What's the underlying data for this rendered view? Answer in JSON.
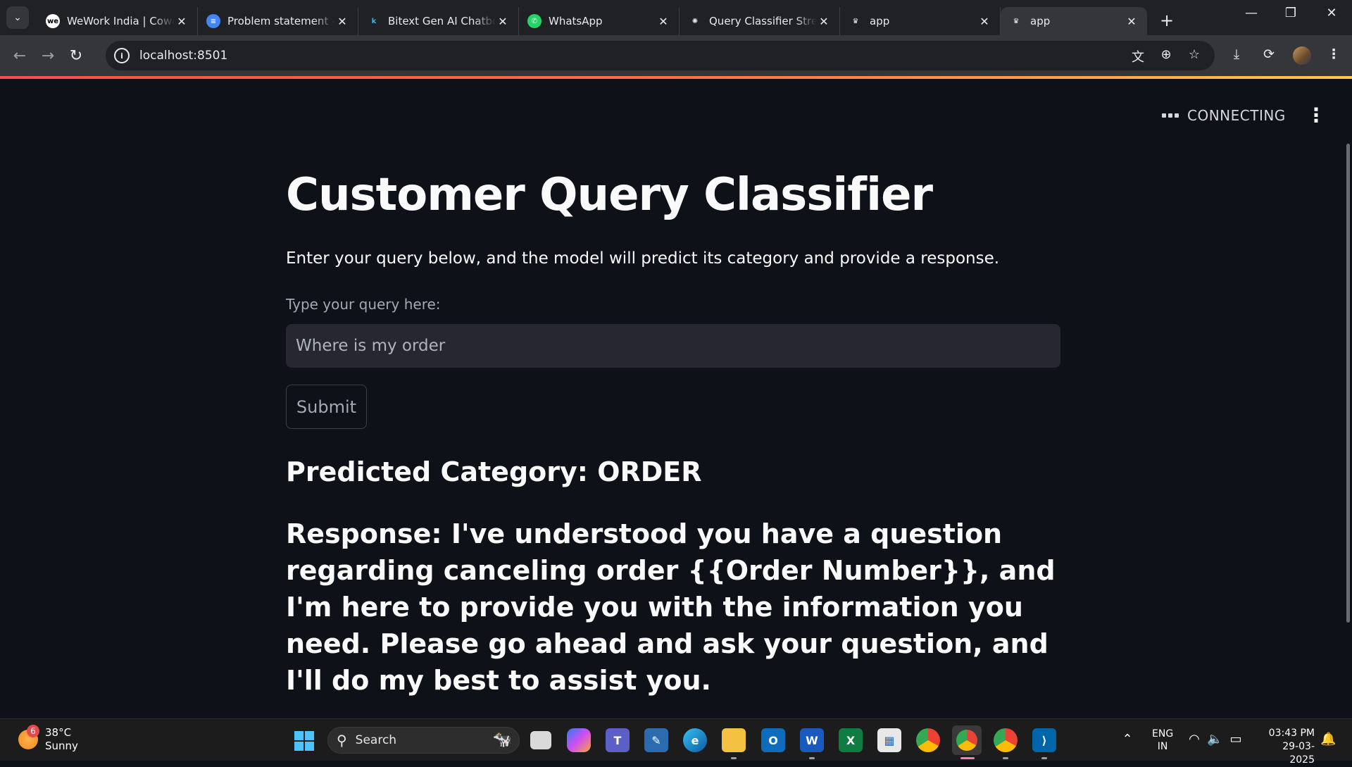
{
  "browser": {
    "tabs": [
      {
        "title": "WeWork India | Cowo",
        "favicon": "wework-icon",
        "icon_text": "we",
        "icon_bg": "#ffffff",
        "icon_fg": "#000000"
      },
      {
        "title": "Problem statement -",
        "favicon": "google-docs-icon",
        "icon_text": "≡",
        "icon_bg": "#4285f4",
        "icon_fg": "#ffffff"
      },
      {
        "title": "Bitext Gen AI Chatbo",
        "favicon": "kaggle-icon",
        "icon_text": "k",
        "icon_bg": "#202124",
        "icon_fg": "#20beff"
      },
      {
        "title": "WhatsApp",
        "favicon": "whatsapp-icon",
        "icon_text": "✆",
        "icon_bg": "#25d366",
        "icon_fg": "#ffffff"
      },
      {
        "title": "Query Classifier Strea",
        "favicon": "openai-icon",
        "icon_text": "✺",
        "icon_bg": "#202124",
        "icon_fg": "#e8eaed"
      },
      {
        "title": "app",
        "favicon": "streamlit-crown-icon",
        "icon_text": "♛",
        "icon_bg": "#202124",
        "icon_fg": "#e8eaed"
      },
      {
        "title": "app",
        "favicon": "streamlit-crown-icon",
        "icon_text": "♛",
        "icon_bg": "#35363a",
        "icon_fg": "#e8eaed"
      }
    ],
    "url": "localhost:8501"
  },
  "app": {
    "status": "CONNECTING",
    "title": "Customer Query Classifier",
    "subtitle": "Enter your query below, and the model will predict its category and provide a response.",
    "input_label": "Type your query here:",
    "input_value": "Where is my order",
    "submit_label": "Submit",
    "predicted": "Predicted Category: ORDER",
    "response": "Response: I've understood you have a question regarding canceling order {{Order Number}}, and I'm here to provide you with the information you need. Please go ahead and ask your question, and I'll do my best to assist you."
  },
  "taskbar": {
    "weather_badge": "6",
    "temperature": "38°C",
    "condition": "Sunny",
    "search_label": "Search",
    "lang_top": "ENG",
    "lang_bottom": "IN",
    "time": "03:43 PM",
    "date": "29-03-2025"
  },
  "colors": {
    "app_bg": "#0e1117",
    "input_bg": "#262730",
    "accent_bar": "#ff4b4b"
  }
}
